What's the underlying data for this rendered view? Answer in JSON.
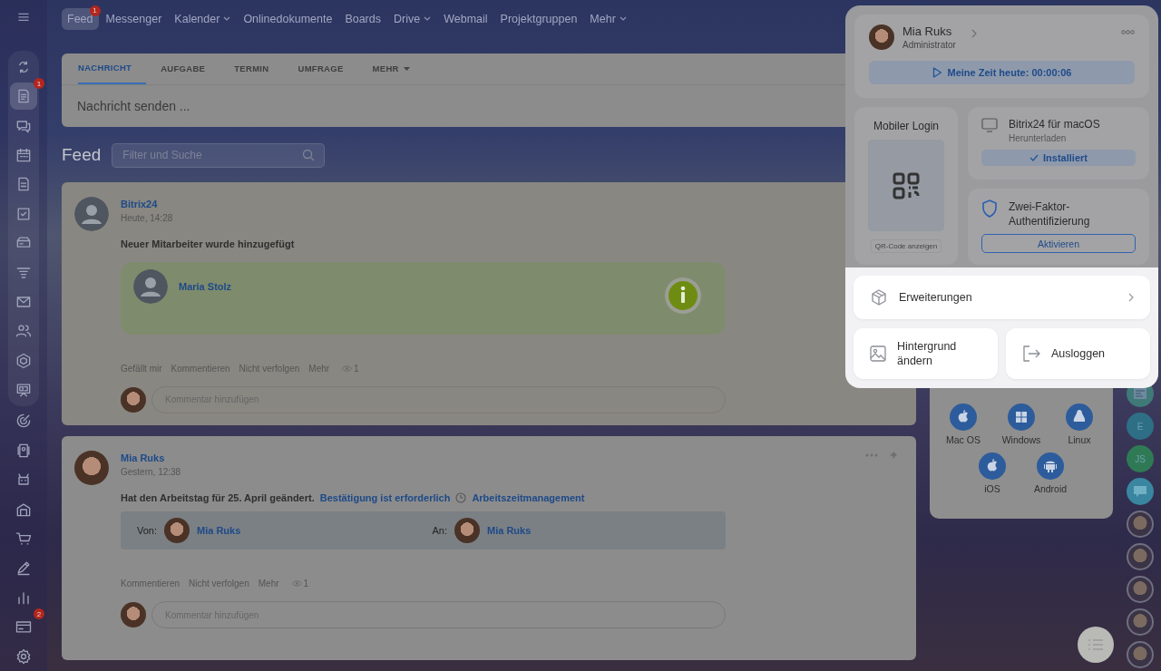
{
  "sidebar": {
    "items": [
      {
        "selected": false
      },
      {
        "selected": true,
        "badge": "1"
      },
      {
        "selected": false
      },
      {
        "selected": false
      },
      {
        "selected": false
      },
      {
        "selected": false
      },
      {
        "selected": false
      },
      {
        "selected": false
      },
      {
        "selected": false
      },
      {
        "selected": false
      },
      {
        "selected": false
      },
      {
        "selected": false
      },
      {
        "selected": false
      },
      {
        "selected": false
      },
      {
        "selected": false
      },
      {
        "selected": false
      },
      {
        "selected": false
      },
      {
        "selected": false
      },
      {
        "selected": false
      },
      {
        "selected": false,
        "badge": "2"
      },
      {
        "selected": false
      }
    ]
  },
  "top_nav": [
    {
      "label": "Feed",
      "selected": true,
      "badge": "1",
      "dropdown": false
    },
    {
      "label": "Messenger",
      "selected": false,
      "dropdown": false
    },
    {
      "label": "Kalender",
      "selected": false,
      "dropdown": true
    },
    {
      "label": "Onlinedokumente",
      "selected": false,
      "dropdown": false
    },
    {
      "label": "Boards",
      "selected": false,
      "dropdown": false
    },
    {
      "label": "Drive",
      "selected": false,
      "dropdown": true
    },
    {
      "label": "Webmail",
      "selected": false,
      "dropdown": false
    },
    {
      "label": "Projektgruppen",
      "selected": false,
      "dropdown": false
    },
    {
      "label": "Mehr",
      "selected": false,
      "dropdown": true
    }
  ],
  "composer": {
    "tabs": [
      {
        "label": "NACHRICHT",
        "selected": true,
        "dropdown": false
      },
      {
        "label": "AUFGABE",
        "selected": false,
        "dropdown": false
      },
      {
        "label": "TERMIN",
        "selected": false,
        "dropdown": false
      },
      {
        "label": "UMFRAGE",
        "selected": false,
        "dropdown": false
      },
      {
        "label": "MEHR",
        "selected": false,
        "dropdown": true
      }
    ],
    "placeholder": "Nachricht senden ..."
  },
  "feed": {
    "title": "Feed",
    "filter_placeholder": "Filter und Suche"
  },
  "posts": [
    {
      "kind": "new_employee",
      "author": "Bitrix24",
      "time": "Heute, 14:28",
      "text": "Neuer Mitarbeiter wurde hinzugefügt",
      "employee": "Maria Stolz",
      "actions": [
        "Gefällt mir",
        "Kommentieren",
        "Nicht verfolgen",
        "Mehr"
      ],
      "views": "1",
      "comment_placeholder": "Kommentar hinzufügen"
    },
    {
      "kind": "workday_change",
      "author": "Mia Ruks",
      "time": "Gestern, 12:38",
      "text": "Hat den Arbeitstag für 25. April geändert.",
      "link": "Bestätigung ist erforderlich",
      "tag": "Arbeitszeitmanagement",
      "from_label": "Von:",
      "from": "Mia Ruks",
      "to_label": "An:",
      "to": "Mia Ruks",
      "actions": [
        "Kommentieren",
        "Nicht verfolgen",
        "Mehr"
      ],
      "views": "1",
      "comment_placeholder": "Kommentar hinzufügen"
    }
  ],
  "profile_popup": {
    "name": "Mia Ruks",
    "role": "Administrator",
    "time_button": "Meine Zeit heute: 00:00:06",
    "mobile": {
      "title": "Mobiler Login",
      "button": "QR-Code anzeigen"
    },
    "desktop": {
      "title": "Bitrix24 für macOS",
      "subtitle": "Herunterladen",
      "button": "Installiert"
    },
    "two_factor": {
      "title": "Zwei-Faktor-Authentifizierung",
      "button": "Aktivieren"
    },
    "menu": [
      {
        "kind": "extensions",
        "label": "Erweiterungen"
      },
      {
        "kind": "background",
        "label": "Hintergrund ändern"
      },
      {
        "kind": "logout",
        "label": "Ausloggen"
      }
    ]
  },
  "downloads": [
    {
      "kind": "apple",
      "label": "Mac OS"
    },
    {
      "kind": "windows",
      "label": "Windows"
    },
    {
      "kind": "linux",
      "label": "Linux"
    },
    {
      "kind": "apple",
      "label": "iOS"
    },
    {
      "kind": "android",
      "label": "Android"
    }
  ],
  "right_rail": [
    {
      "kind": "news",
      "color": "#3f7a78"
    },
    {
      "kind": "letter",
      "text": "E",
      "color": "#2e6f86"
    },
    {
      "kind": "letter",
      "text": "JS",
      "color": "#2f7a55"
    },
    {
      "kind": "chat",
      "color": "#3a86a0"
    },
    {
      "kind": "photo"
    },
    {
      "kind": "photo"
    },
    {
      "kind": "photo"
    },
    {
      "kind": "photo"
    },
    {
      "kind": "photo"
    }
  ]
}
